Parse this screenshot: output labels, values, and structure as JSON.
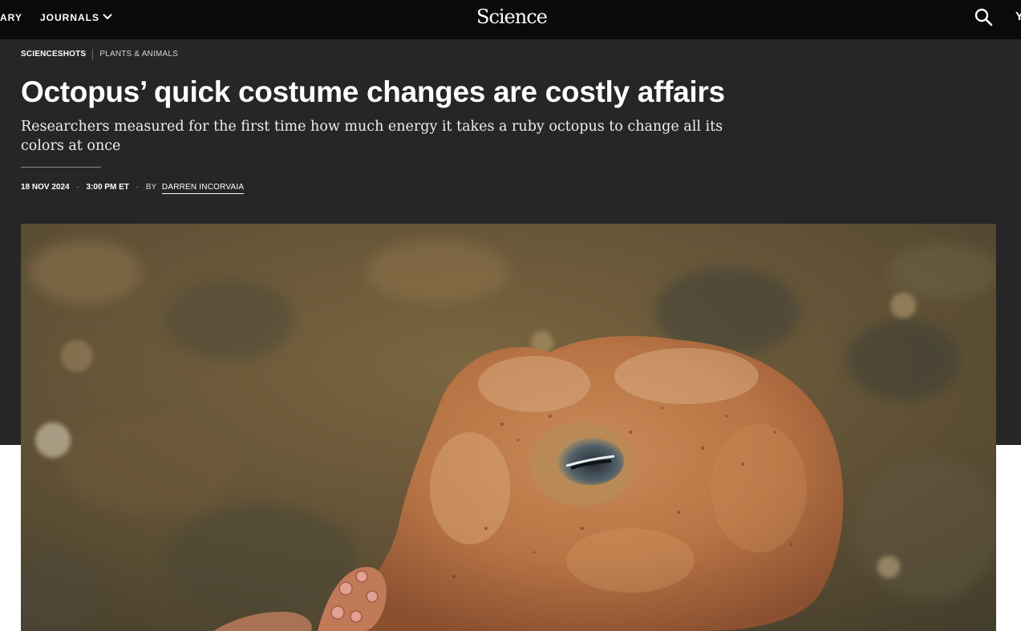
{
  "nav": {
    "library_label": "ARY",
    "journals_label": "JOURNALS",
    "journals_icon": "chevron-down-icon",
    "logo_text": "Science",
    "search_icon": "search-icon",
    "edge_fragment": "Y"
  },
  "article": {
    "section": "SCIENCESHOTS",
    "topic": "PLANTS & ANIMALS",
    "headline": "Octopus’ quick costume changes are costly affairs",
    "dek": "Researchers measured for the first time how much energy it takes a ruby octopus to change all its colors at once",
    "date": "18 NOV 2024",
    "time": "3:00 PM ET",
    "byline_prefix": "BY",
    "author": "DARREN INCORVAIA"
  },
  "colors": {
    "nav_bg": "#0a0a0a",
    "header_bg": "#262626",
    "text": "#ffffff"
  }
}
